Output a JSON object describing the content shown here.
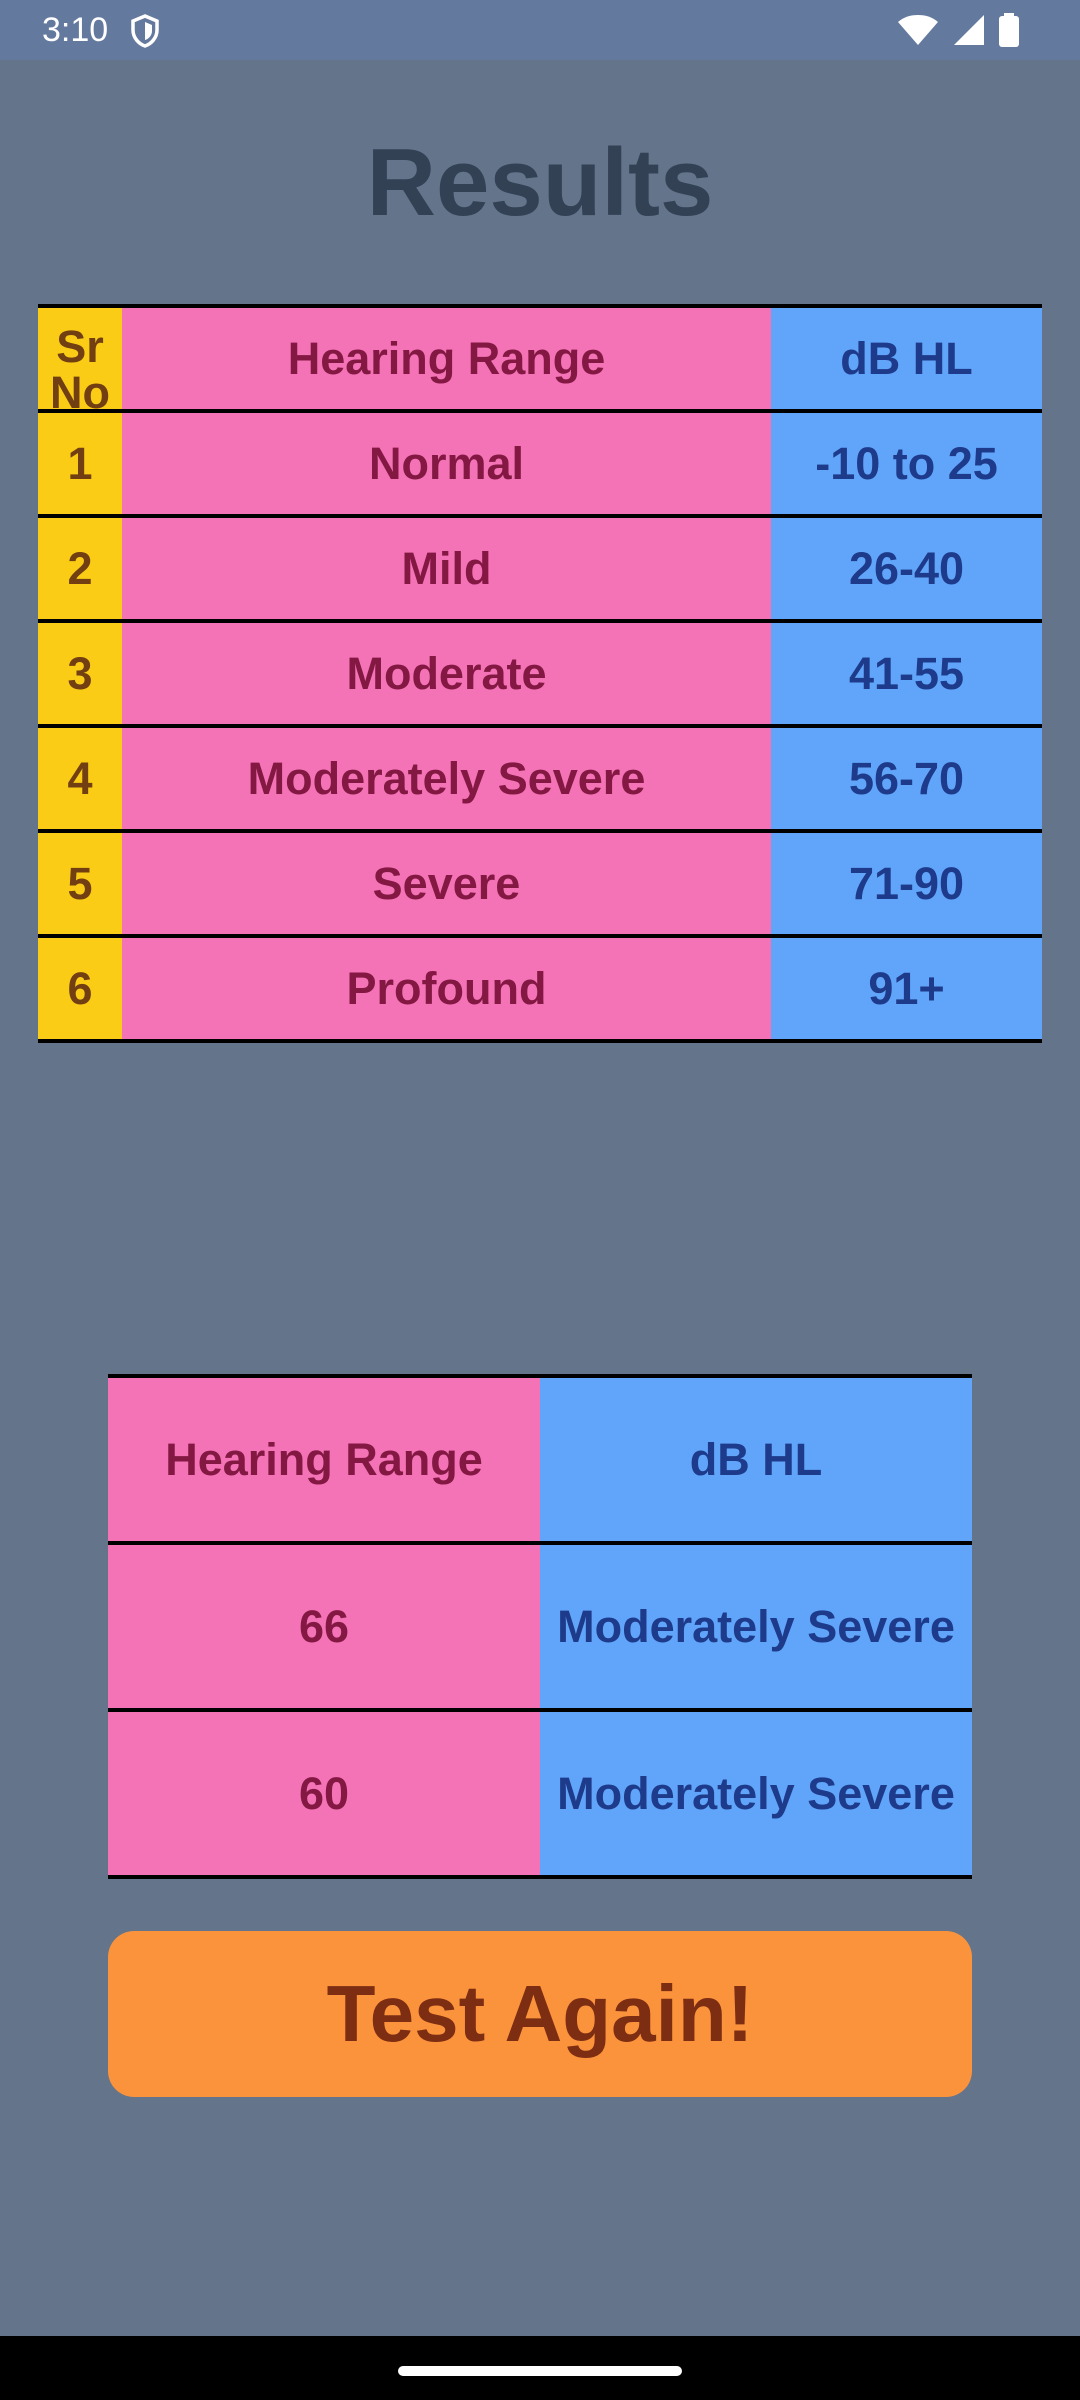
{
  "status_bar": {
    "time": "3:10",
    "icons": [
      "shield-icon",
      "wifi-icon",
      "cell-signal-icon",
      "battery-icon"
    ]
  },
  "page": {
    "title": "Results"
  },
  "reference_table": {
    "headers": {
      "sr": "Sr No",
      "range": "Hearing Range",
      "db": "dB HL"
    },
    "rows": [
      {
        "sr": "1",
        "range": "Normal",
        "db": "-10 to 25"
      },
      {
        "sr": "2",
        "range": "Mild",
        "db": "26-40"
      },
      {
        "sr": "3",
        "range": "Moderate",
        "db": "41-55"
      },
      {
        "sr": "4",
        "range": "Moderately Severe",
        "db": "56-70"
      },
      {
        "sr": "5",
        "range": "Severe",
        "db": "71-90"
      },
      {
        "sr": "6",
        "range": "Profound",
        "db": "91+"
      }
    ]
  },
  "result_table": {
    "headers": {
      "range": "Hearing Range",
      "db": "dB HL"
    },
    "rows": [
      {
        "range": "66",
        "db": "Moderately Severe"
      },
      {
        "range": "60",
        "db": "Moderately Severe"
      }
    ]
  },
  "actions": {
    "test_again_label": "Test Again!"
  },
  "colors": {
    "background": "#64748b",
    "status_bar": "#64799e",
    "sr_column": "#facc15",
    "range_column": "#f472b6",
    "db_column": "#60a5fa",
    "button": "#fb923c"
  }
}
